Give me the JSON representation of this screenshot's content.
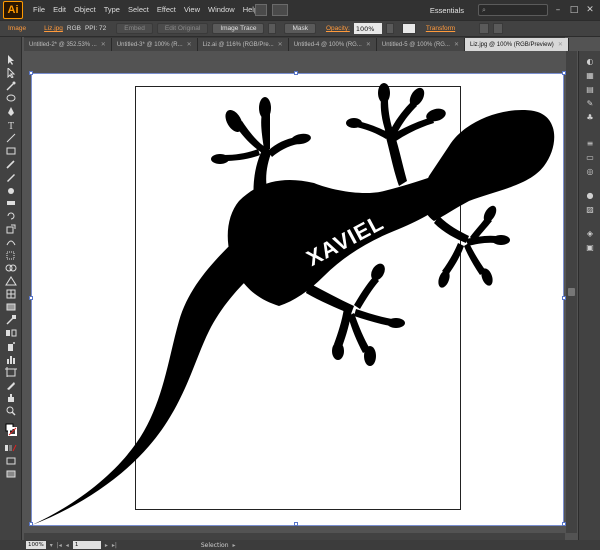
{
  "app": {
    "logo": "Ai"
  },
  "menu": [
    "File",
    "Edit",
    "Object",
    "Type",
    "Select",
    "Effect",
    "View",
    "Window",
    "Help"
  ],
  "workspace": "Essentials",
  "control_bar": {
    "image_label": "Image",
    "file_link": "Liz.jpg",
    "color_mode": "RGB",
    "ppi": "PPI: 72",
    "embed": "Embed",
    "edit_original": "Edit Original",
    "image_trace": "Image Trace",
    "mask": "Mask",
    "opacity_label": "Opacity:",
    "opacity_value": "100%",
    "transform_link": "Transform"
  },
  "tabs": [
    {
      "label": "Untitled-2* @ 352.53% ..."
    },
    {
      "label": "Untitled-3* @ 100% (R..."
    },
    {
      "label": "Liz.ai @ 116% (RGB/Pre..."
    },
    {
      "label": "Untitled-4 @ 100% (RG..."
    },
    {
      "label": "Untitled-5 @ 100% (RG..."
    },
    {
      "label": "Liz.jpg @ 100% (RGB/Preview)"
    }
  ],
  "artwork": {
    "text": "XAVIEL"
  },
  "status": {
    "zoom": "100%",
    "artboard_num": "1",
    "tool_name": "Selection"
  },
  "colors": {
    "accent": "#ff9a00",
    "selection": "#5a77c9",
    "ui_dark": "#424242"
  }
}
